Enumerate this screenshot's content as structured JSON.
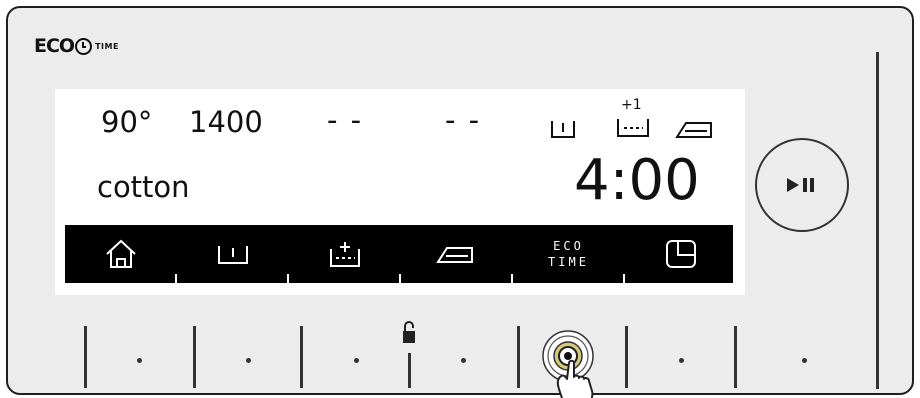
{
  "logo": {
    "eco": "ECO",
    "time": "TIME"
  },
  "display": {
    "temperature": "90°",
    "spin": "1400",
    "option1": "- -",
    "option2": "- -",
    "extra_rinse_label": "+1",
    "program": "cotton",
    "remaining_time": "4:00"
  },
  "menu": {
    "items": [
      {
        "name": "home",
        "icon": "home-icon"
      },
      {
        "name": "prewash",
        "icon": "prewash-icon"
      },
      {
        "name": "extra-rinse",
        "icon": "extra-rinse-icon"
      },
      {
        "name": "easy-iron",
        "icon": "iron-icon"
      },
      {
        "name": "eco-time",
        "line1": "ECO",
        "line2": "TIME"
      },
      {
        "name": "delay-timer",
        "icon": "timer-icon"
      }
    ]
  },
  "controls": {
    "start_pause_icon": "play-pause-icon",
    "child_lock_icon": "padlock-icon",
    "pressed_button_icon": "finger-press-icon"
  },
  "colors": {
    "panel": "#ececec",
    "screen": "#ffffff",
    "menubar": "#000000",
    "accent_ring": "#c9bd6a"
  }
}
